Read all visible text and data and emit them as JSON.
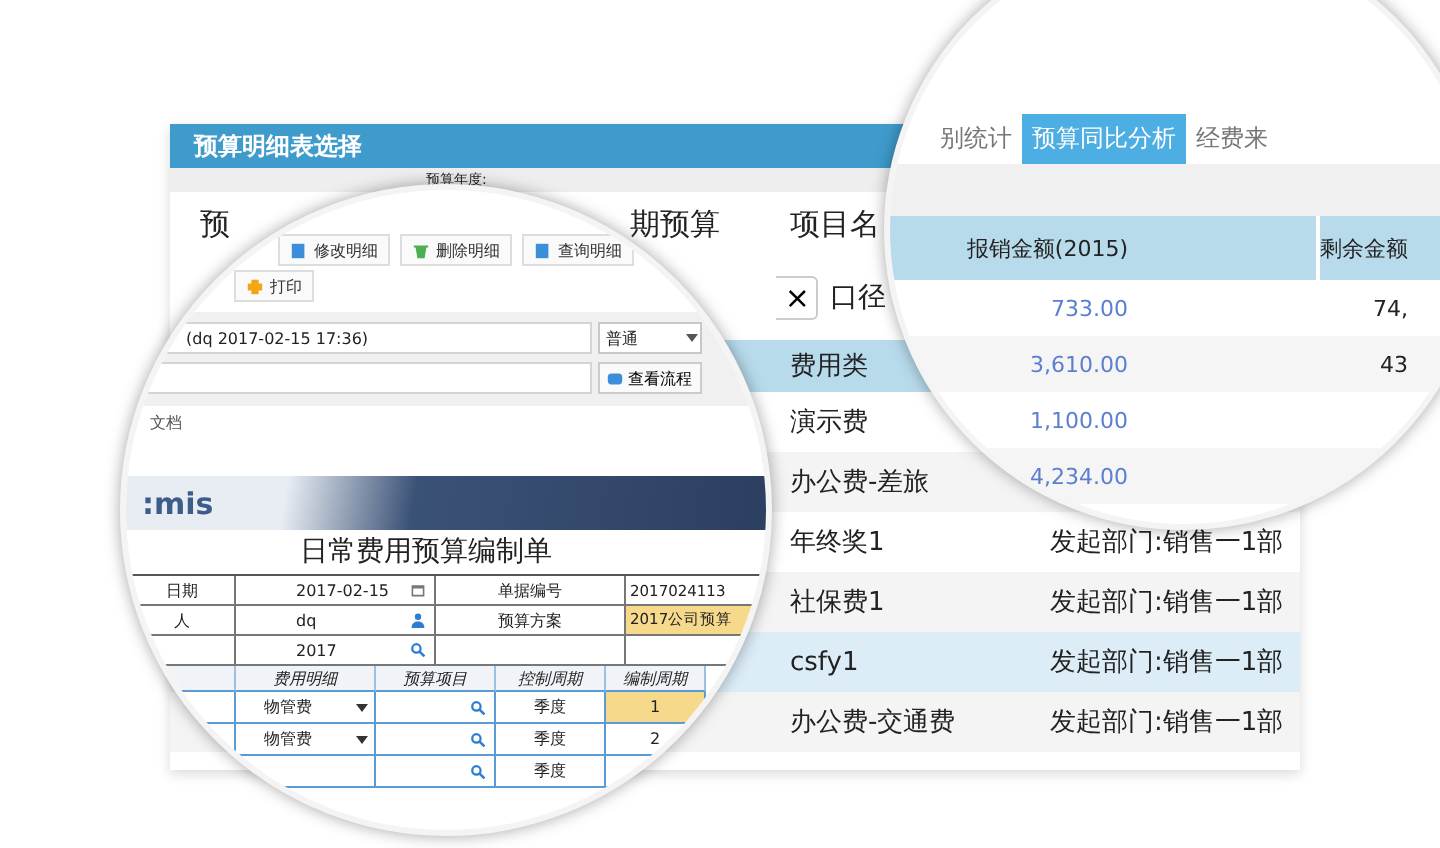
{
  "main_window": {
    "title": "预算明细表选择",
    "filter_label": "预算年度:",
    "heading": "预",
    "heading_2": "期预算",
    "heading_3": "项目名",
    "clear_button": "×",
    "label": "口径",
    "table": {
      "column": "费用类",
      "rows": [
        {
          "name": "演示费",
          "selected": false
        },
        {
          "name": "办公费-差旅",
          "selected": false
        },
        {
          "name": "年终奖1",
          "department": "发起部门:销售一1部",
          "selected": false
        },
        {
          "name": "社保费1",
          "department": "发起部门:销售一1部",
          "selected": false
        },
        {
          "name": "csfy1",
          "department": "发起部门:销售一1部",
          "selected": true
        },
        {
          "name": "办公费-交通费",
          "department": "发起部门:销售一1部",
          "selected": false
        }
      ]
    }
  },
  "left_lens": {
    "toolbar": [
      {
        "label": "修改明细",
        "kind": "edit"
      },
      {
        "label": "删除明细",
        "kind": "delete"
      },
      {
        "label": "查询明细",
        "kind": "query"
      }
    ],
    "print_button": "打印",
    "subject_field": "(dq 2017-02-15 17:36)",
    "priority_select": "普通",
    "flow_button": "查看流程",
    "attachment_label": "文档",
    "logo": ":mis",
    "form_title": "日常费用预算编制单",
    "form_rows": [
      {
        "label": "日期",
        "value": "2017-02-15",
        "kind": "date",
        "label_2": "单据编号",
        "value_2": "2017024113",
        "highlighted": false
      },
      {
        "label": "人",
        "value": "dq",
        "kind": "user",
        "label_2": "预算方案",
        "value_2": "2017公司预算",
        "highlighted": true
      },
      {
        "value": "2017",
        "kind": "lookup",
        "highlighted": false
      }
    ],
    "detail_table": {
      "columns": [
        "费用明细",
        "预算项目",
        "控制周期",
        "编制周期"
      ],
      "rows": [
        {
          "expense": "物管费",
          "period": "季度",
          "cycle": "1",
          "selected": true
        },
        {
          "expense": "物管费",
          "period": "季度",
          "cycle": "2",
          "selected": false
        },
        {
          "period": "季度",
          "selected": false
        }
      ]
    }
  },
  "right_lens": {
    "tabs": [
      {
        "label": "别统计",
        "selected": false
      },
      {
        "label": "预算同比分析",
        "selected": true
      },
      {
        "label": "经费来",
        "selected": false
      }
    ],
    "columns": [
      "报销金额(2015)",
      "剩余金额"
    ],
    "rows": [
      {
        "amount": "733.00",
        "remaining": "74,"
      },
      {
        "amount": "3,610.00",
        "remaining": "43"
      },
      {
        "amount": "1,100.00"
      },
      {
        "amount": "4,234.00"
      }
    ]
  }
}
